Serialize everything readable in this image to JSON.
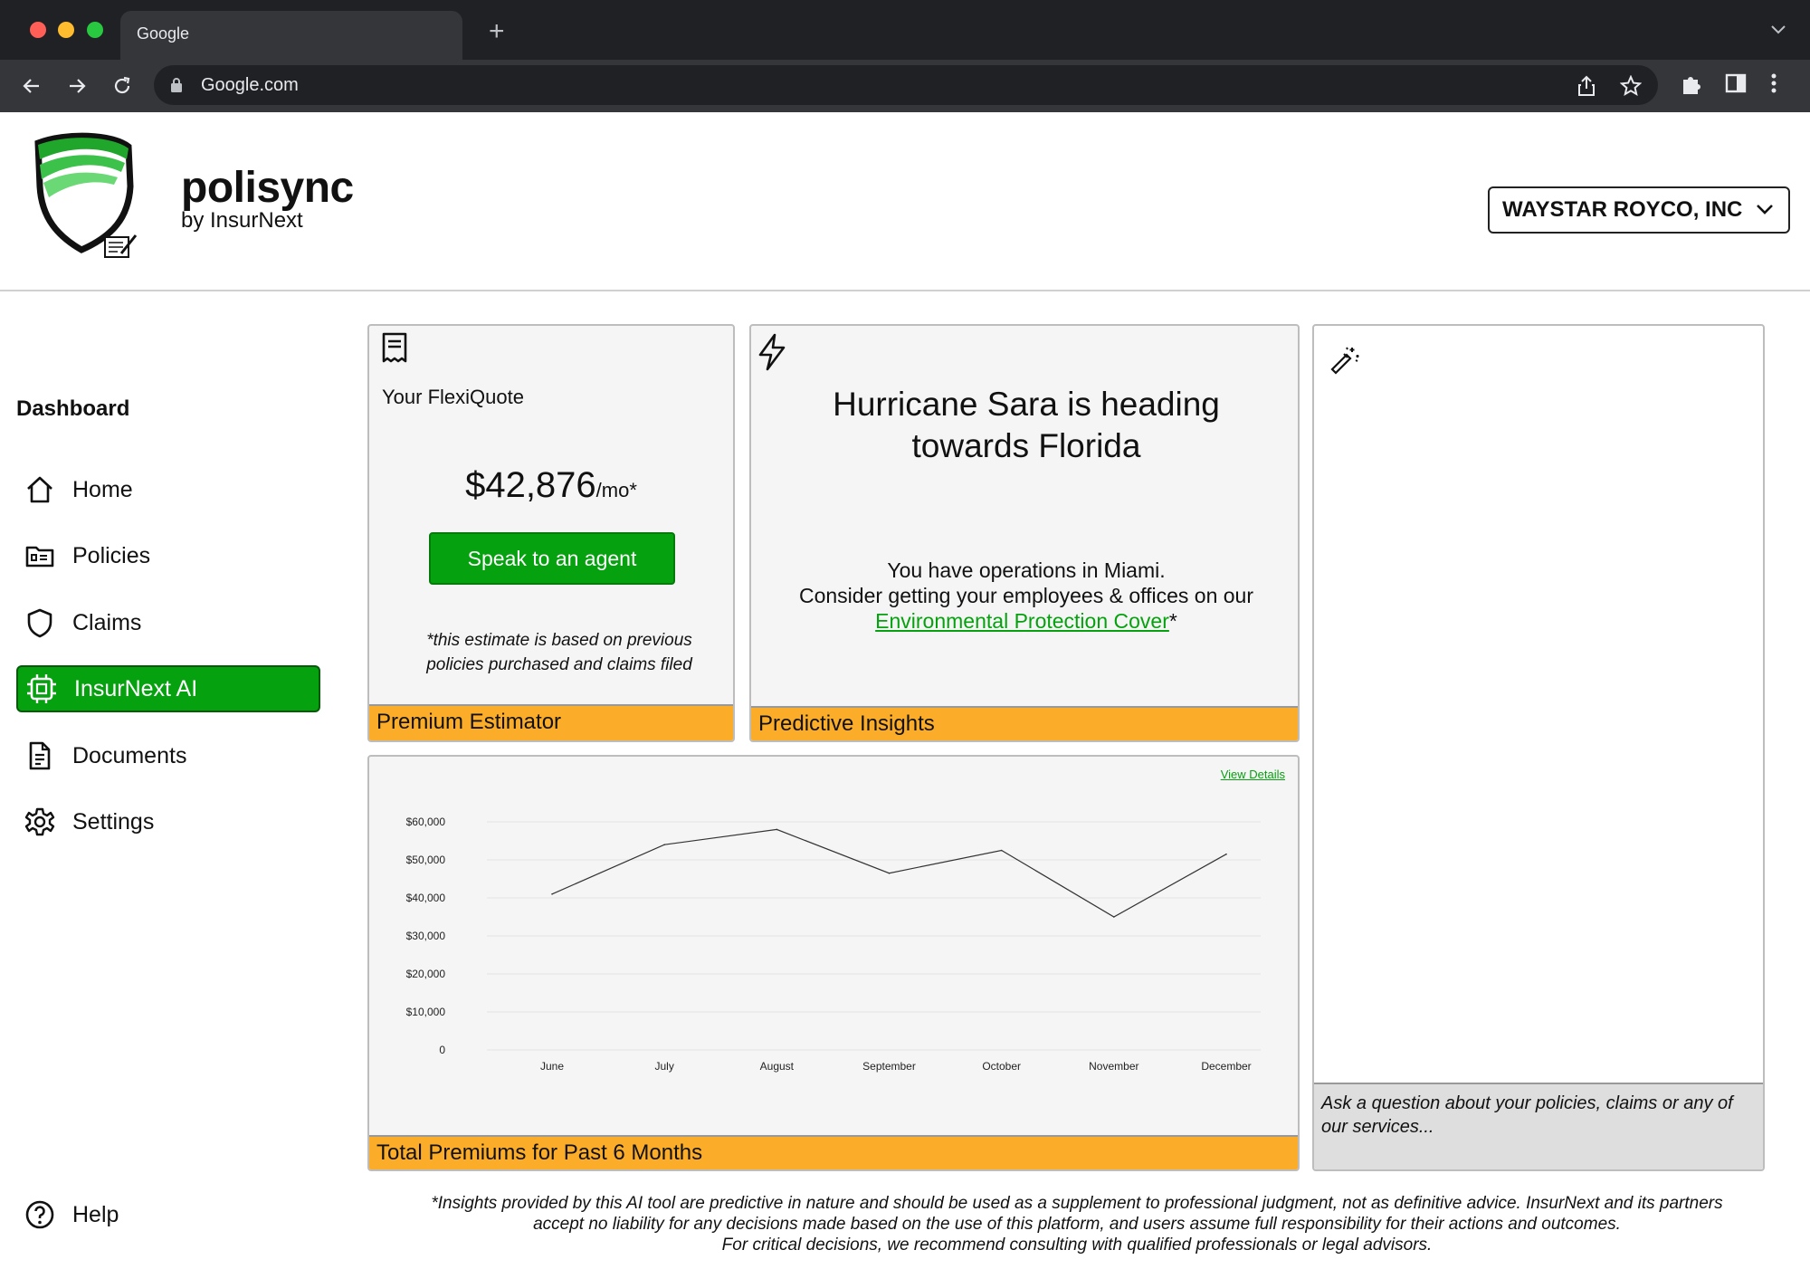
{
  "browser": {
    "tab_title": "Google",
    "new_tab_symbol": "+",
    "url": "Google.com"
  },
  "app": {
    "brand": "polisync",
    "brand_sub": "by InsurNext",
    "company": "WAYSTAR ROYCO, INC",
    "accent_color": "#06a10f",
    "footer_color": "#fbad2a"
  },
  "sidebar": {
    "title": "Dashboard",
    "items": [
      {
        "label": "Home",
        "icon": "home-icon"
      },
      {
        "label": "Policies",
        "icon": "folder-icon"
      },
      {
        "label": "Claims",
        "icon": "shield-icon"
      },
      {
        "label": "InsurNext AI",
        "icon": "chip-icon",
        "active": true
      },
      {
        "label": "Documents",
        "icon": "document-icon"
      },
      {
        "label": "Settings",
        "icon": "gear-icon"
      }
    ],
    "help_label": "Help"
  },
  "quote": {
    "label": "Your FlexiQuote",
    "price": "$42,876",
    "unit": "/mo*",
    "button": "Speak to an agent",
    "note": "*this estimate is based on previous policies purchased and claims filed",
    "footer": "Premium Estimator"
  },
  "insight": {
    "title": "Hurricane Sara is heading towards Florida",
    "body_line1": "You have operations in Miami.",
    "body_line2": "Consider getting your employees & offices on our",
    "link": "Environmental Protection Cover",
    "link_suffix": "*",
    "footer": "Predictive Insights"
  },
  "chart_card": {
    "view_details": "View Details",
    "footer": "Total Premiums for Past 6 Months"
  },
  "chart_data": {
    "type": "line",
    "categories": [
      "June",
      "July",
      "August",
      "September",
      "October",
      "November",
      "December"
    ],
    "values": [
      41000,
      54000,
      58000,
      46500,
      52500,
      35000,
      51500
    ],
    "y_ticks": [
      {
        "value": 0,
        "label": "0"
      },
      {
        "value": 10000,
        "label": "$10,000"
      },
      {
        "value": 20000,
        "label": "$20,000"
      },
      {
        "value": 30000,
        "label": "$30,000"
      },
      {
        "value": 40000,
        "label": "$40,000"
      },
      {
        "value": 50000,
        "label": "$50,000"
      },
      {
        "value": 60000,
        "label": "$60,000"
      }
    ],
    "ylim": [
      0,
      60000
    ],
    "grid": true,
    "title": "",
    "xlabel": "",
    "ylabel": ""
  },
  "ai": {
    "placeholder": "Ask a question about your policies, claims or any of our services..."
  },
  "disclaimer": {
    "line1": "*Insights provided by this AI tool are predictive in nature and should be used as a supplement to professional judgment, not as definitive advice. InsurNext and its partners",
    "line2": "accept no liability for any decisions made based on the use of this platform, and users assume full responsibility for their actions and outcomes.",
    "line3": "For critical decisions, we recommend consulting with qualified professionals or legal advisors."
  }
}
